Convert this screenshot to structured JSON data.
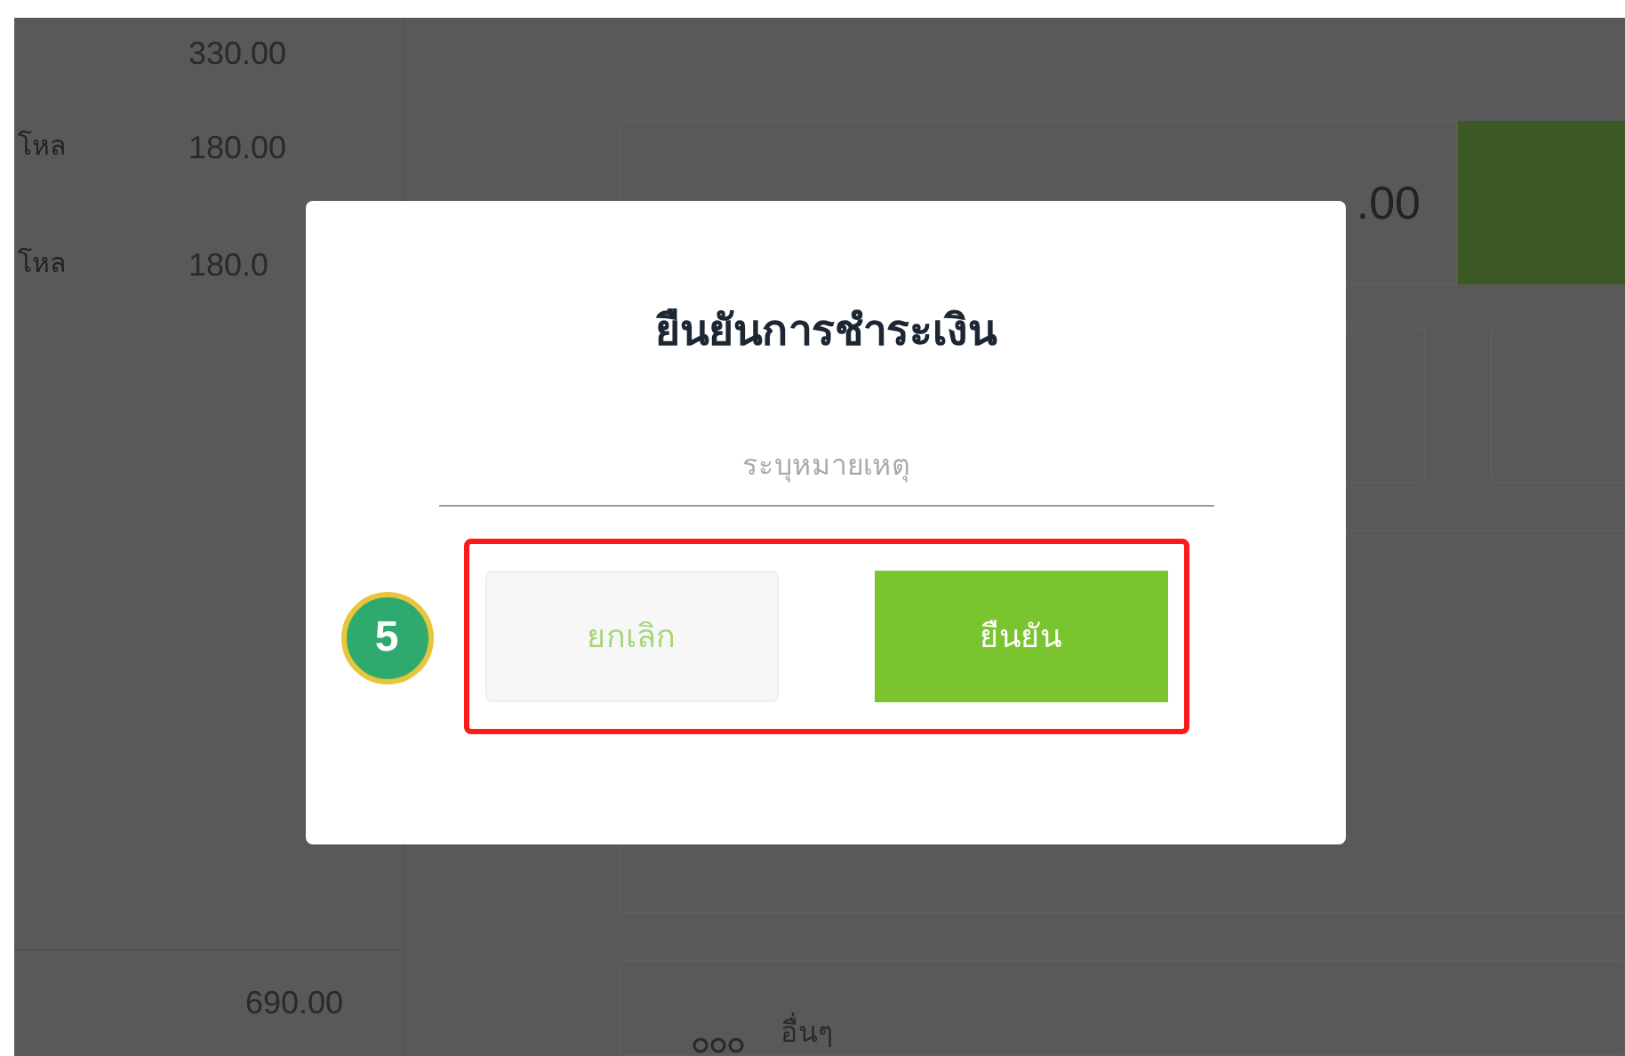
{
  "order_list": {
    "rows": [
      {
        "unit": "",
        "amount": "330.00"
      },
      {
        "unit": "โหล",
        "amount": "180.00"
      },
      {
        "unit": "โหล",
        "amount": "180.0"
      }
    ],
    "total": "690.00"
  },
  "payment": {
    "cash_amount": ".00",
    "other_label": "อื่นๆ"
  },
  "dialog": {
    "title": "ยืนยันการชำระเงิน",
    "note_field": {
      "placeholder": "ระบุหมายเหตุ"
    },
    "buttons": [
      {
        "kind": "cancel",
        "label": "ยกเลิก"
      },
      {
        "kind": "confirm",
        "label": "ยืนยัน"
      }
    ],
    "step_badge": "5"
  }
}
